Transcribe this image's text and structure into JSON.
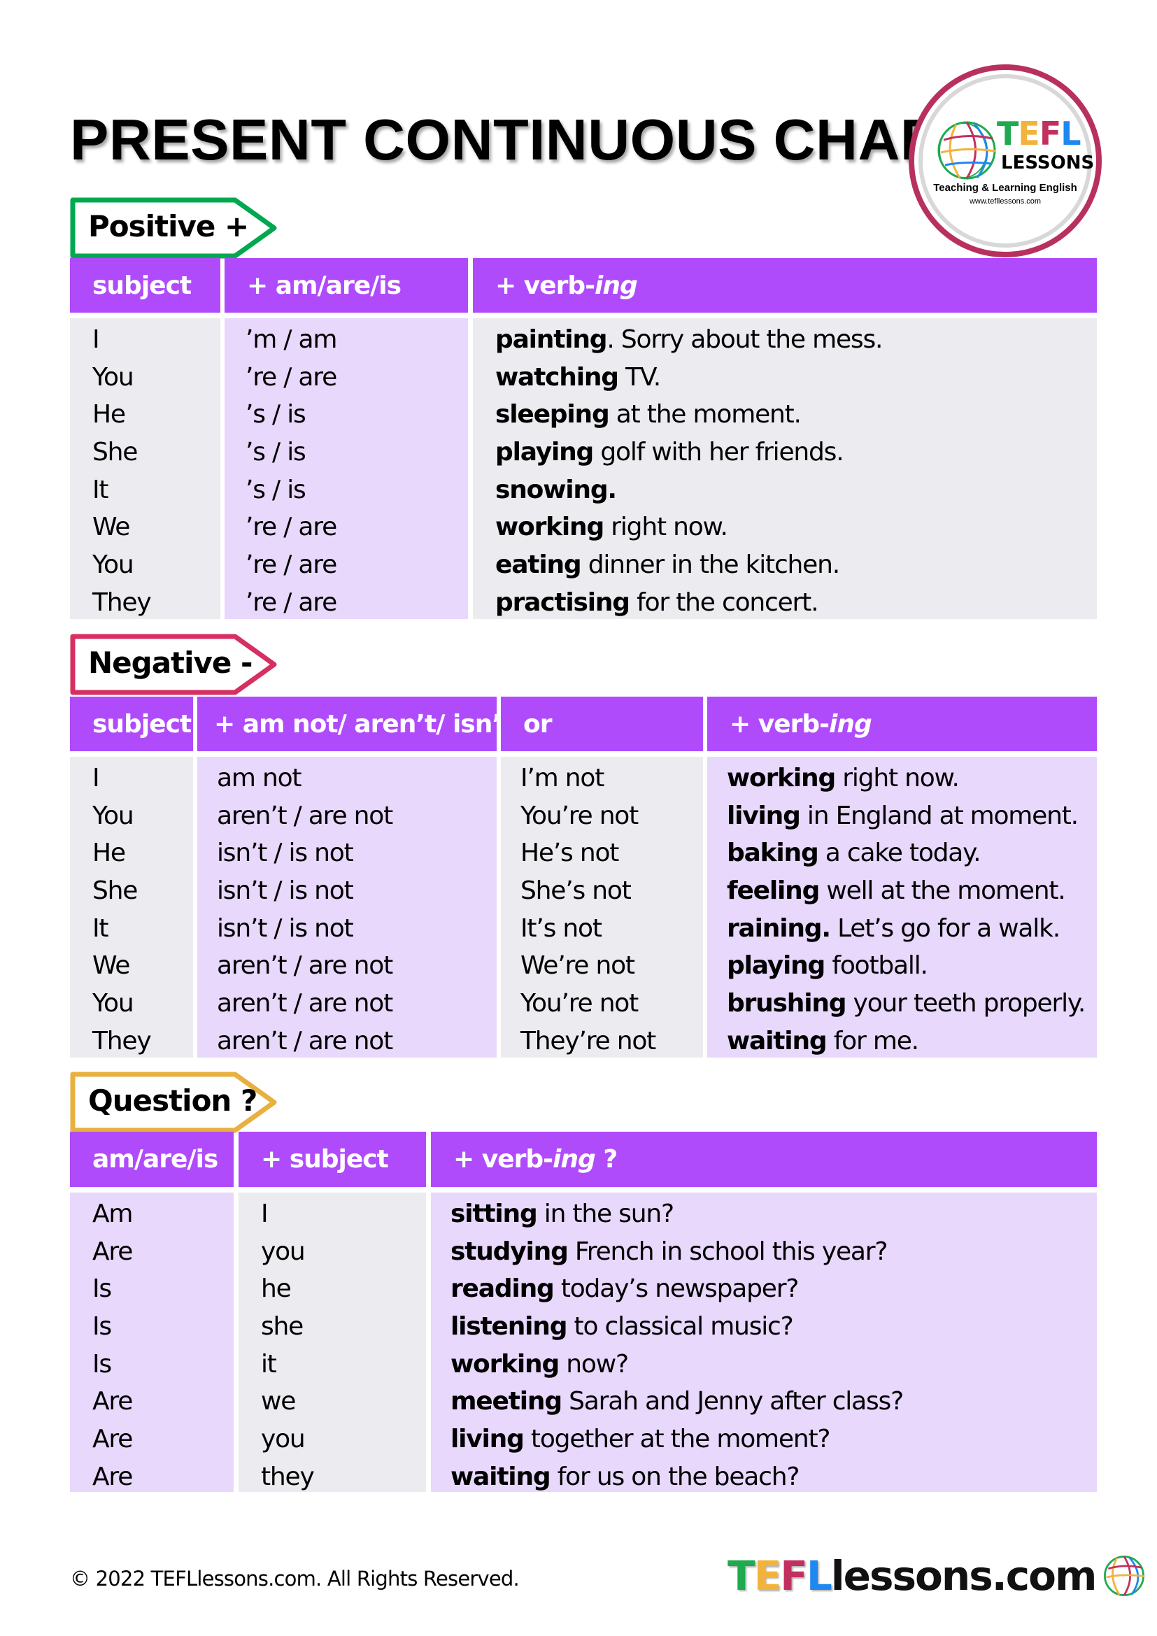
{
  "title": "PRESENT CONTINUOUS CHART",
  "logo": {
    "letters": [
      {
        "char": "T",
        "color": "#1faa4f"
      },
      {
        "char": "E",
        "color": "#f2b33d"
      },
      {
        "char": "F",
        "color": "#c2305f"
      },
      {
        "char": "L",
        "color": "#1e88f0"
      }
    ],
    "lessons": "LESSONS",
    "tagline": "Teaching  & Learning English",
    "url": "www.tefllessons.com",
    "ring_color": "#b8305f"
  },
  "colors": {
    "header": "#b04bfc",
    "cell_grey": "#ebebf0",
    "cell_lavender": "#e8d8fc",
    "positive_tag": "#00a94f",
    "negative_tag": "#d63062",
    "question_tag": "#e8b040"
  },
  "positive": {
    "tag": "Positive +",
    "headers": [
      "subject",
      "+ am/are/is",
      "+ verb-",
      "ing"
    ],
    "subjects": [
      "I",
      "You",
      "He",
      "She",
      "It",
      "We",
      "You",
      "They"
    ],
    "be": [
      "’m / am",
      "’re / are",
      "’s / is",
      "’s / is",
      "’s / is",
      "’re / are",
      "’re / are",
      "’re / are"
    ],
    "verbs": [
      {
        "bold": "painting",
        "rest": ". Sorry about the mess."
      },
      {
        "bold": "watching",
        "rest": " TV."
      },
      {
        "bold": "sleeping",
        "rest": " at the moment."
      },
      {
        "bold": "playing",
        "rest": " golf with her friends."
      },
      {
        "bold": "snowing.",
        "rest": ""
      },
      {
        "bold": "working",
        "rest": " right now."
      },
      {
        "bold": "eating",
        "rest": " dinner in the kitchen."
      },
      {
        "bold": "practising",
        "rest": " for the concert."
      }
    ]
  },
  "negative": {
    "tag": "Negative -",
    "headers": [
      "subject",
      "+ am not/ aren’t/ isn’t",
      "or",
      "+ verb-",
      "ing"
    ],
    "subjects": [
      "I",
      "You",
      "He",
      "She",
      "It",
      "We",
      "You",
      "They"
    ],
    "full": [
      "am not",
      "aren’t / are not",
      "isn’t / is not",
      "isn’t / is not",
      "isn’t / is not",
      "aren’t / are not",
      "aren’t / are not",
      "aren’t / are not"
    ],
    "short": [
      "I’m not",
      "You’re not",
      "He’s not",
      "She’s not",
      "It’s not",
      "We’re not",
      "You’re not",
      "They’re not"
    ],
    "verbs": [
      {
        "bold": "working",
        "rest": " right now."
      },
      {
        "bold": "living",
        "rest": " in England at moment."
      },
      {
        "bold": "baking",
        "rest": " a cake today."
      },
      {
        "bold": "feeling",
        "rest": " well at the moment."
      },
      {
        "bold": "raining.",
        "rest": " Let’s go for a walk."
      },
      {
        "bold": "playing",
        "rest": " football."
      },
      {
        "bold": "brushing",
        "rest": " your teeth properly."
      },
      {
        "bold": "waiting",
        "rest": " for me."
      }
    ]
  },
  "question": {
    "tag": "Question ?",
    "headers": [
      "am/are/is",
      "+ subject",
      "+ verb-",
      "ing",
      " ?"
    ],
    "be": [
      "Am",
      "Are",
      "Is",
      "Is",
      "Is",
      "Are",
      "Are",
      "Are"
    ],
    "subjects": [
      "I",
      "you",
      "he",
      "she",
      "it",
      "we",
      "you",
      "they"
    ],
    "verbs": [
      {
        "bold": "sitting",
        "rest": " in the sun?"
      },
      {
        "bold": "studying",
        "rest": " French in school this year?"
      },
      {
        "bold": "reading",
        "rest": " today’s newspaper?"
      },
      {
        "bold": "listening",
        "rest": " to classical music?"
      },
      {
        "bold": "working",
        "rest": " now?"
      },
      {
        "bold": "meeting",
        "rest": " Sarah and Jenny after class?"
      },
      {
        "bold": "living",
        "rest": " together at the moment?"
      },
      {
        "bold": "waiting",
        "rest": " for us on the beach?"
      }
    ]
  },
  "footer": {
    "copyright": "© 2022 TEFLlessons.com. All Rights Reserved.",
    "brand_rest": "lessons.com"
  }
}
